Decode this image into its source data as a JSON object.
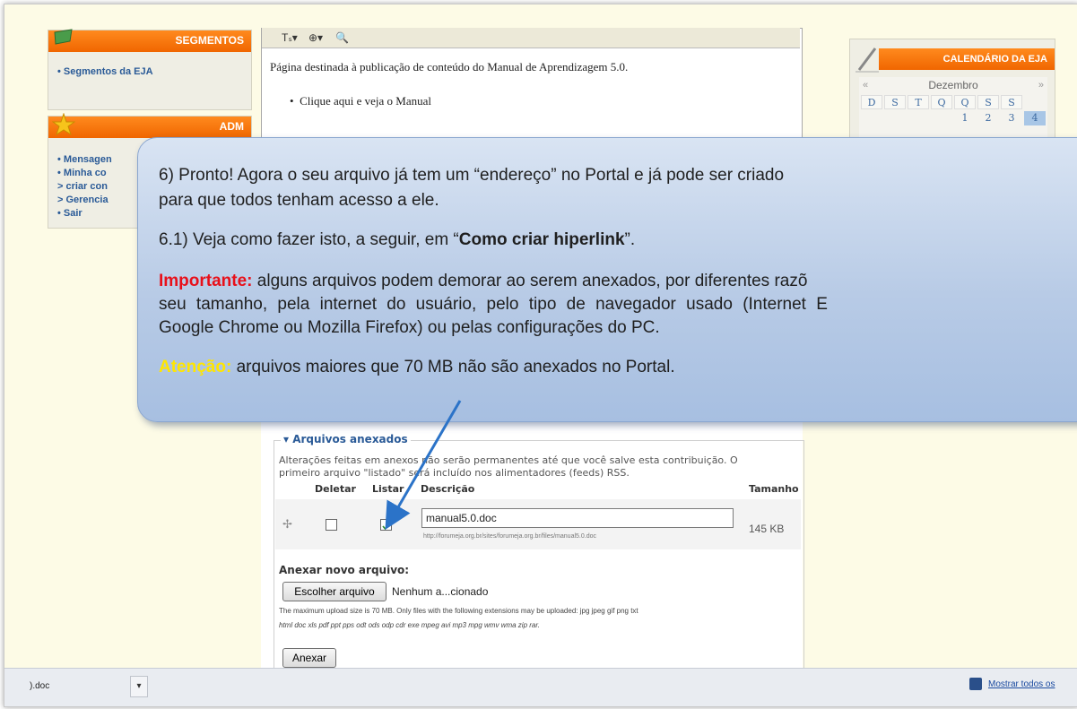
{
  "left": {
    "segments": {
      "title": "SEGMENTOS",
      "items": [
        "• Segmentos da EJA"
      ]
    },
    "adm": {
      "title": "ADM",
      "items": [
        "• Mensagen",
        "• Minha co",
        "> criar con",
        "> Gerencia",
        "• Sair"
      ]
    }
  },
  "editor": {
    "toolbar_icons": [
      "Tₛ▾",
      "⊕▾",
      "🔍"
    ],
    "text": "Página destinada à publicação de conteúdo do Manual de Aprendizagem 5.0.",
    "bullet": "Clique aqui e veja o Manual"
  },
  "calendar": {
    "title": "CALENDÁRIO DA EJA",
    "prev": "«",
    "next": "»",
    "month": "Dezembro",
    "weekdays": [
      "D",
      "S",
      "T",
      "Q",
      "Q",
      "S",
      "S"
    ],
    "days": [
      "",
      "",
      "",
      "",
      "1",
      "2",
      "3",
      "4"
    ]
  },
  "callout": {
    "p1_line1": "6) Pronto! Agora o seu arquivo já tem um “endereço” no Portal e já pode ser criado",
    "p1_line2": "para que todos tenham acesso a ele.",
    "p2_pre": "6.1) Veja como fazer isto, a seguir, em “",
    "p2_bold": "Como criar hiperlink",
    "p2_post": "”.",
    "p3_label": "Importante:",
    "p3_line1": " alguns arquivos podem demorar ao serem anexados, por diferentes razõ",
    "p3_line2": "seu tamanho, pela internet do usuário, pelo tipo de navegador usado (Internet E",
    "p3_line3": "Google Chrome ou Mozilla Firefox) ou pelas configurações do PC.",
    "p4_label": "Atenção:",
    "p4_text": " arquivos maiores que 70 MB não são anexados no Portal.",
    "colors": {
      "important": "#e8101a",
      "attention": "#ffe600",
      "arrow": "#2b73c8"
    }
  },
  "attachments": {
    "legend": "▾ Arquivos anexados",
    "note_line1": "Alterações feitas em anexos não serão permanentes até que você salve esta contribuição. O",
    "note_line2": "primeiro arquivo \"listado\" será incluído nos alimentadores (feeds) RSS.",
    "headers": {
      "delete": "Deletar",
      "list": "Listar",
      "description": "Descrição",
      "size": "Tamanho"
    },
    "row": {
      "handle": "✢",
      "delete_checked": false,
      "list_checked": true,
      "filename": "manual5.0.doc",
      "url": "http://forumeja.org.br/sites/forumeja.org.br/files/manual5.0.doc",
      "size": "145 KB"
    },
    "new_title": "Anexar novo arquivo:",
    "choose_button": "Escolher arquivo",
    "no_file": "Nenhum a...cionado",
    "help_line1": "The maximum upload size is 70 MB. Only files with the following extensions may be uploaded: jpg jpeg gif png txt",
    "help_line2": "html doc xls pdf ppt pps odt ods odp cdr exe mpeg avi mp3 mpg wmv wma zip rar.",
    "attach_button": "Anexar"
  },
  "download_bar": {
    "file": ").doc",
    "dropdown": "▾",
    "show_all": "Mostrar todos os"
  }
}
